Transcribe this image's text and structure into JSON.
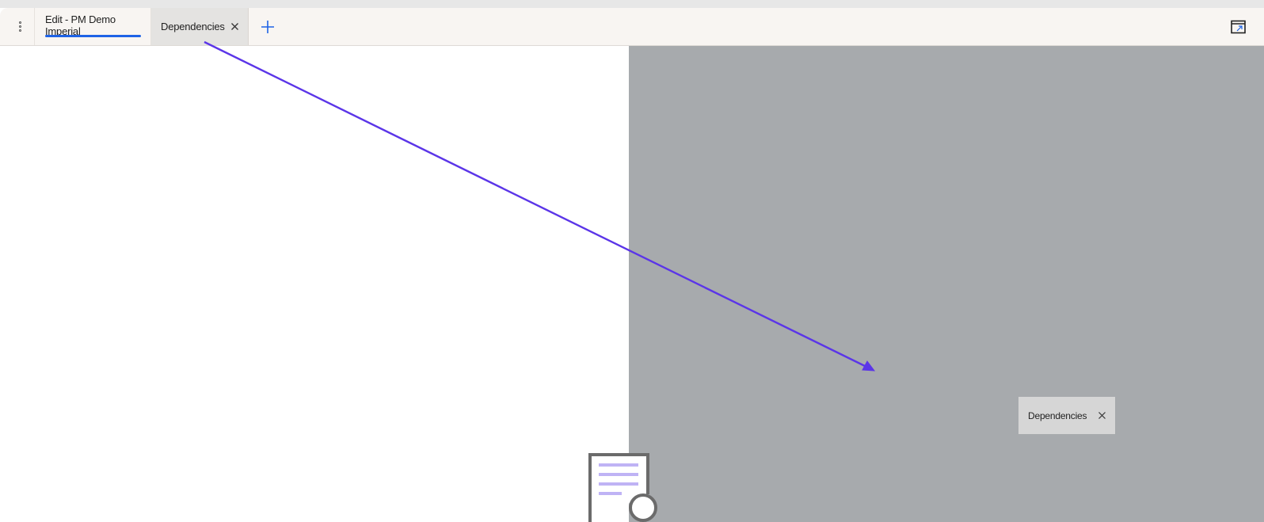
{
  "tab_bar": {
    "menu_icon": "kebab-menu-icon",
    "tabs": [
      {
        "label": "Edit - PM Demo Imperial",
        "active": true
      },
      {
        "label": "Dependencies",
        "active": false,
        "close_icon": "close-icon"
      }
    ],
    "add_icon": "plus-icon",
    "corner_icon": "window-icon"
  },
  "drag_ghost": {
    "label": "Dependencies",
    "close_icon": "close-icon"
  },
  "illustration": {
    "icon": "document-search-icon"
  },
  "colors": {
    "accent": "#1e63e6",
    "tab_bar_bg": "#f8f5f2",
    "overlay_panel": "#a7aaad",
    "arrow": "#5b35e8",
    "illustration_lines": "#bfb3f5"
  }
}
